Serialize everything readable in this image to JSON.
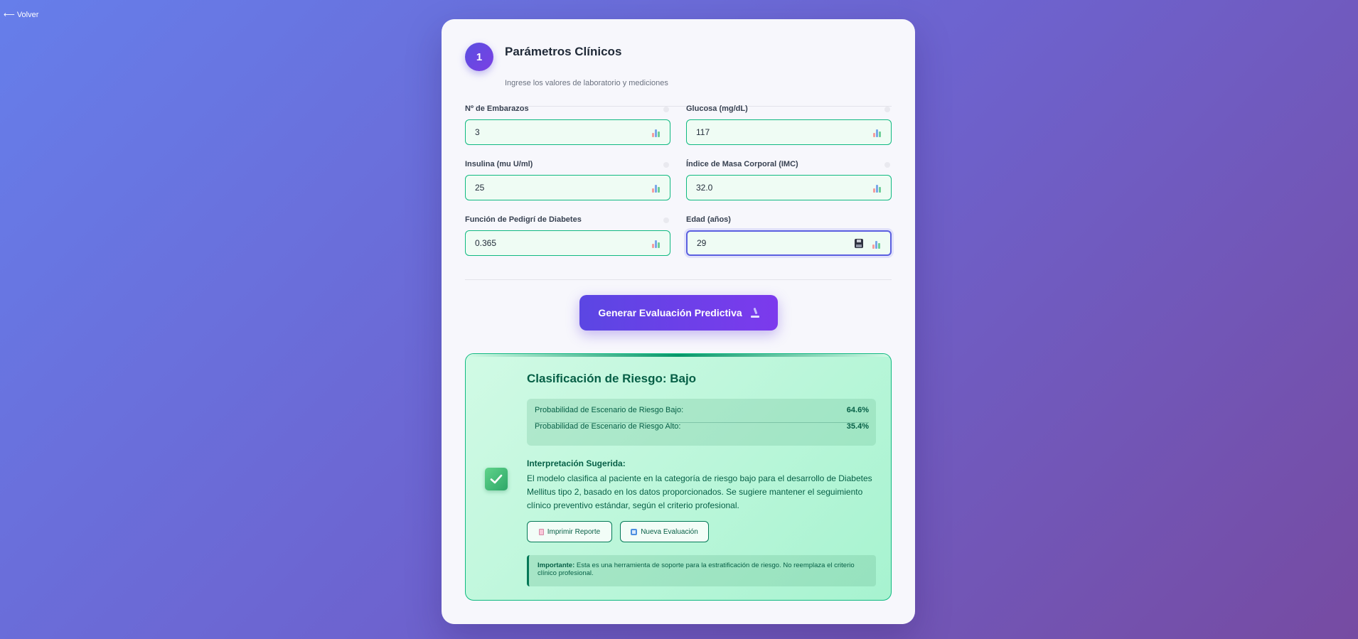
{
  "nav": {
    "back_label": "⟵ Volver"
  },
  "header": {
    "step_number": "1",
    "title": "Parámetros Clínicos",
    "subtitle": "Ingrese los valores de laboratorio y mediciones"
  },
  "fields": [
    {
      "label": "Nº de Embarazos",
      "value": "3"
    },
    {
      "label": "Glucosa (mg/dL)",
      "value": "117"
    },
    {
      "label": "Insulina (mu U/ml)",
      "value": "25"
    },
    {
      "label": "Índice de Masa Corporal (IMC)",
      "value": "32.0"
    },
    {
      "label": "Función de Pedigrí de Diabetes",
      "value": "0.365"
    },
    {
      "label": "Edad (años)",
      "value": "29"
    }
  ],
  "submit_label": "Generar Evaluación Predictiva",
  "result": {
    "title": "Clasificación de Riesgo: Bajo",
    "probabilities": [
      {
        "label": "Probabilidad de Escenario de Riesgo Bajo:",
        "value": "64.6%"
      },
      {
        "label": "Probabilidad de Escenario de Riesgo Alto:",
        "value": "35.4%"
      }
    ],
    "interpretation_title": "Interpretación Sugerida:",
    "interpretation_text": "El modelo clasifica al paciente en la categoría de riesgo bajo para el desarrollo de Diabetes Mellitus tipo 2, basado en los datos proporcionados. Se sugiere mantener el seguimiento clínico preventivo estándar, según el criterio profesional.",
    "print_label": "Imprimir Reporte",
    "new_label": "Nueva Evaluación",
    "notice_strong": "Importante:",
    "notice_text": " Esta es una herramienta de soporte para la estratificación de riesgo. No reemplaza el criterio clínico profesional."
  },
  "colors": {
    "accent": "#5b46e3",
    "success": "#10b981",
    "success_dark": "#065f46"
  }
}
